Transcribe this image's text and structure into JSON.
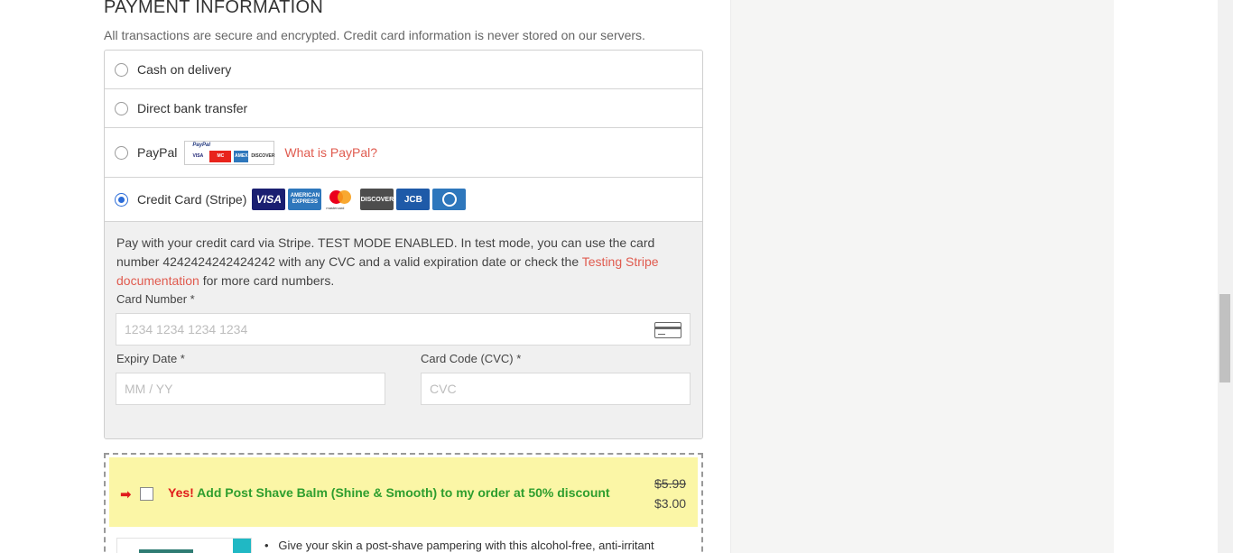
{
  "payment": {
    "heading": "PAYMENT INFORMATION",
    "subtitle": "All transactions are secure and encrypted. Credit card information is never stored on our servers.",
    "methods": [
      {
        "label": "Cash on delivery",
        "selected": false
      },
      {
        "label": "Direct bank transfer",
        "selected": false
      },
      {
        "label": "PayPal",
        "selected": false,
        "link": "What is PayPal?"
      },
      {
        "label": "Credit Card (Stripe)",
        "selected": true
      }
    ],
    "paypal_logo_text": "PayPal",
    "paypal_logo_cards": [
      "VISA",
      "MC",
      "AMEX",
      "DISCOVER"
    ],
    "card_brands": [
      "VISA",
      "AMERICAN EXPRESS",
      "mastercard",
      "DISCOVER",
      "JCB",
      "Diners Club"
    ],
    "stripe": {
      "desc_before": "Pay with your credit card via Stripe. TEST MODE ENABLED. In test mode, you can use the card number 4242424242424242 with any CVC and a valid expiration date or check the ",
      "desc_link": "Testing Stripe documentation",
      "desc_after": " for more card numbers.",
      "card_number_label": "Card Number *",
      "card_number_placeholder": "1234 1234 1234 1234",
      "expiry_label": "Expiry Date *",
      "expiry_placeholder": "MM / YY",
      "cvc_label": "Card Code (CVC) *",
      "cvc_placeholder": "CVC"
    }
  },
  "offer": {
    "arrow": "➡",
    "yes": "Yes!",
    "text": " Add Post Shave Balm (Shine & Smooth) to my order at 50% discount",
    "old_price": "$5.99",
    "new_price": "$3.00",
    "bullet": "Give your skin a post-shave pampering with this alcohol-free, anti-irritant"
  },
  "colors": {
    "link": "#e05b4f",
    "offer_bg": "#fbf6a6",
    "offer_text": "#2e9e2e",
    "yes": "#e01b1b"
  }
}
